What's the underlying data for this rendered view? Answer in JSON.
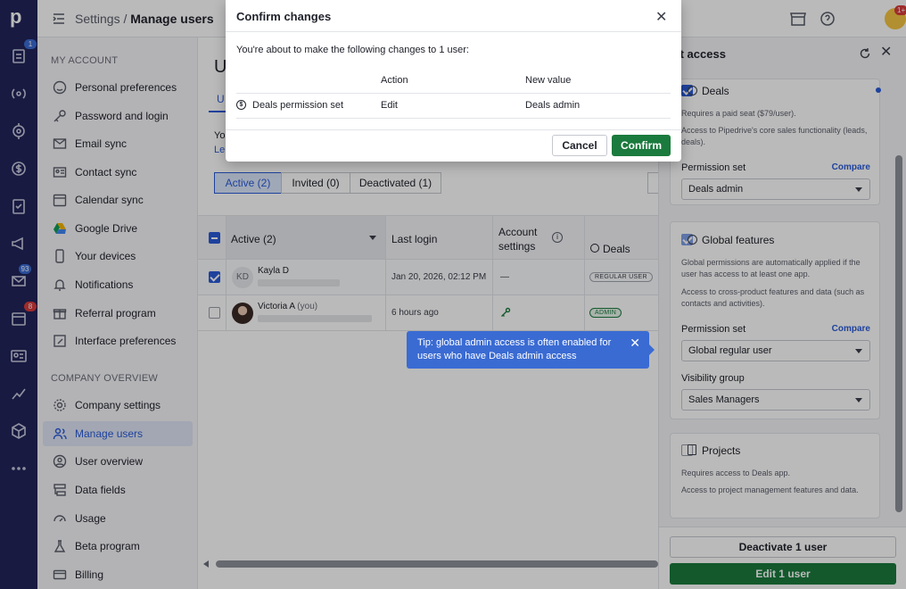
{
  "header": {
    "breadcrumb_parent": "Settings",
    "breadcrumb_sep": "/",
    "breadcrumb_current": "Manage users",
    "notifications_badge": "1+"
  },
  "rail": {
    "logo": "p",
    "badges": {
      "leads": "1",
      "mail": "93",
      "activities": "8"
    }
  },
  "sidebar": {
    "my_account_title": "MY ACCOUNT",
    "my_account": [
      {
        "label": "Personal preferences",
        "icon": "smile-icon"
      },
      {
        "label": "Password and login",
        "icon": "key-icon"
      },
      {
        "label": "Email sync",
        "icon": "mail-icon"
      },
      {
        "label": "Contact sync",
        "icon": "contact-card-icon"
      },
      {
        "label": "Calendar sync",
        "icon": "calendar-icon"
      },
      {
        "label": "Google Drive",
        "icon": "google-drive-icon"
      },
      {
        "label": "Your devices",
        "icon": "phone-icon"
      },
      {
        "label": "Notifications",
        "icon": "bell-icon"
      },
      {
        "label": "Referral program",
        "icon": "gift-icon"
      },
      {
        "label": "Interface preferences",
        "icon": "brush-icon"
      }
    ],
    "company_title": "COMPANY OVERVIEW",
    "company": [
      {
        "label": "Company settings",
        "icon": "gear-icon"
      },
      {
        "label": "Manage users",
        "icon": "users-icon"
      },
      {
        "label": "User overview",
        "icon": "user-circle-icon"
      },
      {
        "label": "Data fields",
        "icon": "data-fields-icon"
      },
      {
        "label": "Usage",
        "icon": "gauge-icon"
      },
      {
        "label": "Beta program",
        "icon": "flask-icon"
      },
      {
        "label": "Billing",
        "icon": "credit-card-icon"
      }
    ]
  },
  "main": {
    "title_partial": "U",
    "tab_partial": "U",
    "text_partial_1": "Yo",
    "text_partial_2": "Le",
    "filters": [
      "Active (2)",
      "Invited (0)",
      "Deactivated (1)"
    ],
    "columns": {
      "name": "Active (2)",
      "last_login": "Last login",
      "account_settings": "Account settings",
      "deals": "Deals"
    },
    "rows": [
      {
        "initials": "KD",
        "name": "Kayla D",
        "you": "",
        "last_login": "Jan 20, 2026, 02:12 PM",
        "account_settings": "—",
        "deals_badge": "REGULAR USER",
        "checked": true
      },
      {
        "initials": "",
        "name": "Victoria A",
        "you": "(you)",
        "last_login": "6 hours ago",
        "account_settings": "",
        "deals_badge": "ADMIN",
        "checked": false
      }
    ]
  },
  "tooltip": {
    "text": "Tip: global admin access is often enabled for users who have Deals admin access"
  },
  "right_panel": {
    "title": "it access",
    "deals": {
      "title": "Deals",
      "desc1": "Requires a paid seat ($79/user).",
      "desc2": "Access to Pipedrive's core sales functionality (leads, deals).",
      "permission_label": "Permission set",
      "compare": "Compare",
      "permission_value": "Deals admin"
    },
    "global": {
      "title": "Global features",
      "desc1": "Global permissions are automatically applied if the user has access to at least one app.",
      "desc2": "Access to cross-product features and data (such as contacts and activities).",
      "permission_label": "Permission set",
      "compare": "Compare",
      "permission_value": "Global regular user",
      "visibility_label": "Visibility group",
      "visibility_value": "Sales Managers"
    },
    "projects": {
      "title": "Projects",
      "desc1": "Requires access to Deals app.",
      "desc2": "Access to project management features and data."
    },
    "deactivate_button": "Deactivate 1 user",
    "edit_button": "Edit 1 user"
  },
  "modal": {
    "title": "Confirm changes",
    "intro": "You're about to make the following changes to 1 user:",
    "col_action": "Action",
    "col_new_value": "New value",
    "change_item": "Deals permission set",
    "change_action": "Edit",
    "change_new_value": "Deals admin",
    "cancel": "Cancel",
    "confirm": "Confirm"
  },
  "colors": {
    "rail": "#21245a",
    "accent_blue": "#2a5bd7",
    "confirm_green": "#1b7a3d",
    "tooltip_blue": "#3a6bd3"
  }
}
